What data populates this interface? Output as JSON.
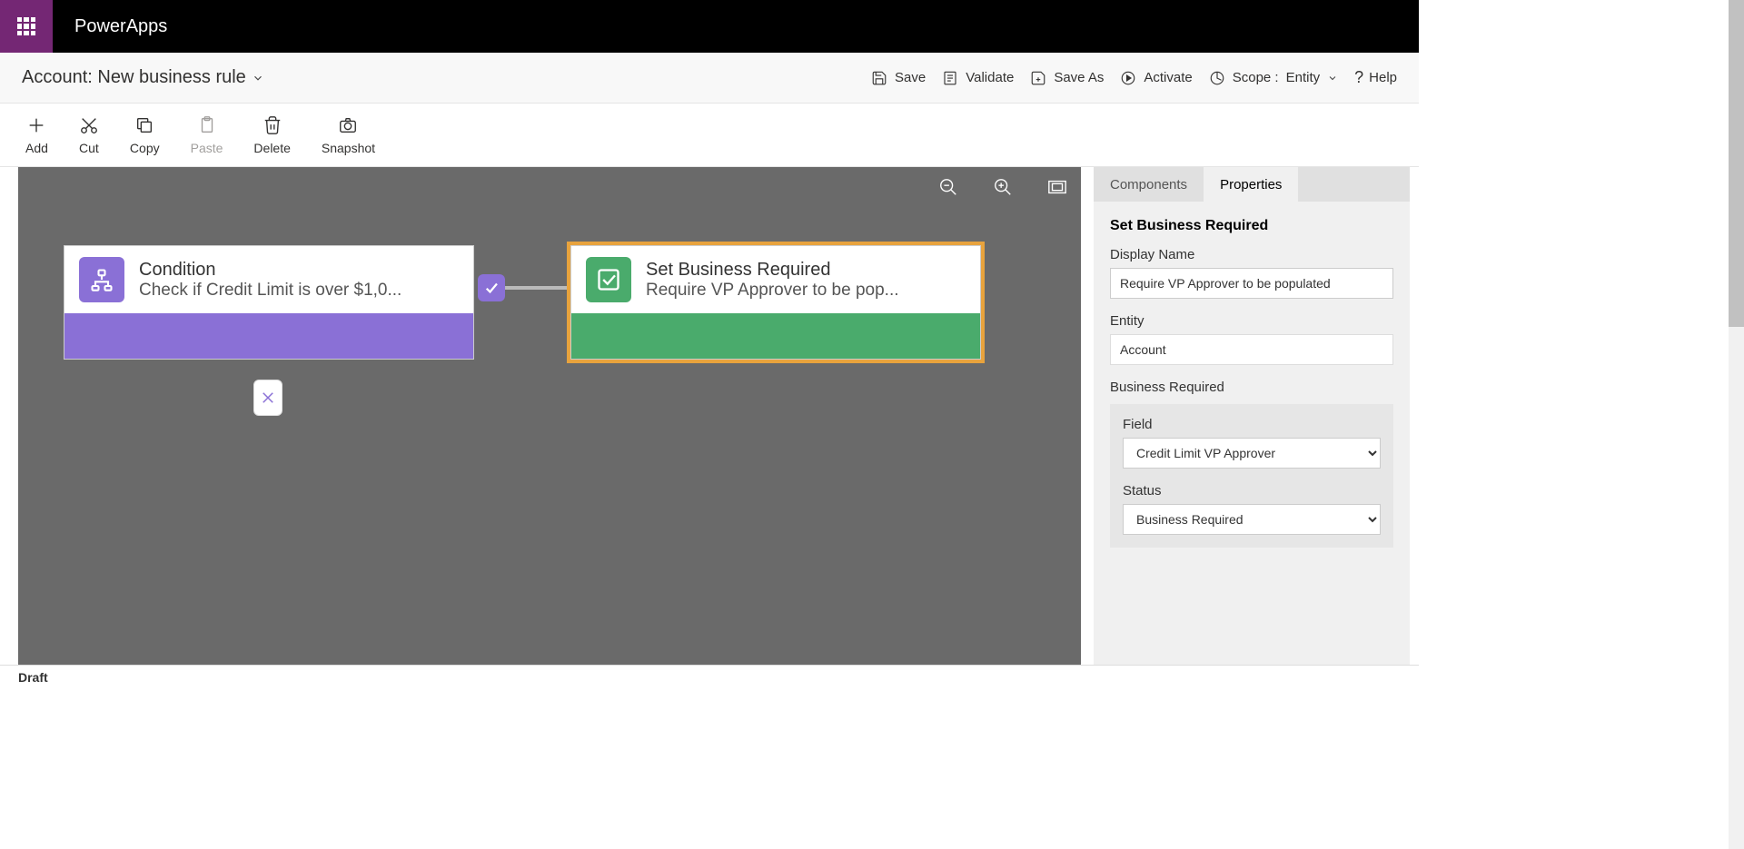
{
  "topbar": {
    "app_name": "PowerApps"
  },
  "subhead": {
    "title": "Account: New business rule",
    "actions": {
      "save": "Save",
      "validate": "Validate",
      "save_as": "Save As",
      "activate": "Activate",
      "scope_label": "Scope :",
      "scope_value": "Entity",
      "help": "Help"
    }
  },
  "toolbar": {
    "add": "Add",
    "cut": "Cut",
    "copy": "Copy",
    "paste": "Paste",
    "delete": "Delete",
    "snapshot": "Snapshot"
  },
  "canvas": {
    "condition": {
      "title": "Condition",
      "subtitle": "Check if Credit Limit is over $1,0..."
    },
    "action": {
      "title": "Set Business Required",
      "subtitle": "Require VP Approver to be pop..."
    }
  },
  "panel": {
    "tabs": {
      "components": "Components",
      "properties": "Properties"
    },
    "section_title": "Set Business Required",
    "display_name_label": "Display Name",
    "display_name_value": "Require VP Approver to be populated",
    "entity_label": "Entity",
    "entity_value": "Account",
    "br_label": "Business Required",
    "field_label": "Field",
    "field_value": "Credit Limit VP Approver",
    "status_label": "Status",
    "status_value": "Business Required"
  },
  "statusbar": {
    "text": "Draft"
  }
}
